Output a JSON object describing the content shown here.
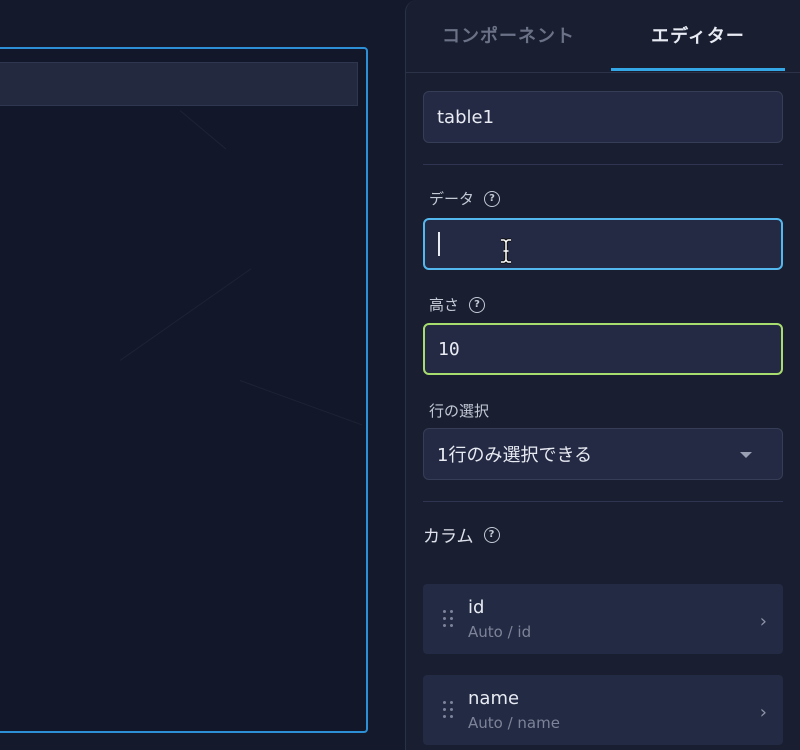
{
  "tabs": [
    {
      "label": "コンポーネント",
      "active": false
    },
    {
      "label": "エディター",
      "active": true
    }
  ],
  "editor": {
    "component_name": "table1",
    "data_label": "データ",
    "data_value": "",
    "height_label": "高さ",
    "height_value": "10",
    "row_select_label": "行の選択",
    "row_select_value": "1行のみ選択できる",
    "columns_label": "カラム",
    "columns": [
      {
        "name": "id",
        "sub": "Auto / id"
      },
      {
        "name": "name",
        "sub": "Auto / name"
      }
    ]
  },
  "icons": {
    "help": "help-circle-icon",
    "dropdown": "chevron-down-icon",
    "drag": "drag-handle-icon",
    "chevron": "chevron-right-icon",
    "cursor": "text-cursor-icon"
  },
  "colors": {
    "accent": "#34a7e6",
    "focus_border": "#54b8ee",
    "valid_border": "#a7dd6e",
    "canvas_selection": "#2d8fd6"
  }
}
